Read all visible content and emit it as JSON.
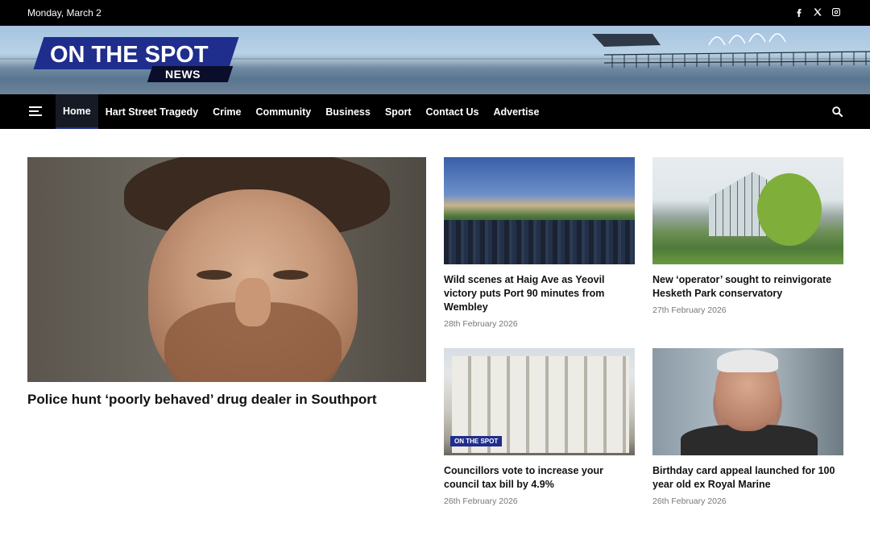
{
  "topbar": {
    "date": "Monday, March 2",
    "social": [
      "facebook-icon",
      "x-icon",
      "instagram-icon"
    ]
  },
  "logo": {
    "line1": "ON THE SPOT",
    "line2": "NEWS"
  },
  "nav": {
    "items": [
      {
        "label": "Home",
        "active": true
      },
      {
        "label": "Hart Street Tragedy"
      },
      {
        "label": "Crime"
      },
      {
        "label": "Community"
      },
      {
        "label": "Business"
      },
      {
        "label": "Sport"
      },
      {
        "label": "Contact Us"
      },
      {
        "label": "Advertise"
      }
    ]
  },
  "feature": {
    "title": "Police hunt ‘poorly behaved’ drug dealer in Southport"
  },
  "cards": [
    {
      "title": "Wild scenes at Haig Ave as Yeovil victory puts Port 90 minutes from Wembley",
      "date": "28th February 2026"
    },
    {
      "title": "New ‘operator’ sought to reinvigorate Hesketh Park conservatory",
      "date": "27th February 2026"
    },
    {
      "title": "Councillors vote to increase your council tax bill by 4.9%",
      "date": "26th February 2026",
      "badge": "ON THE SPOT"
    },
    {
      "title": "Birthday card appeal launched for 100 year old ex Royal Marine",
      "date": "26th February 2026"
    }
  ],
  "colors": {
    "brand": "#1f2d8c",
    "bar": "#000000",
    "meta": "#777777"
  }
}
